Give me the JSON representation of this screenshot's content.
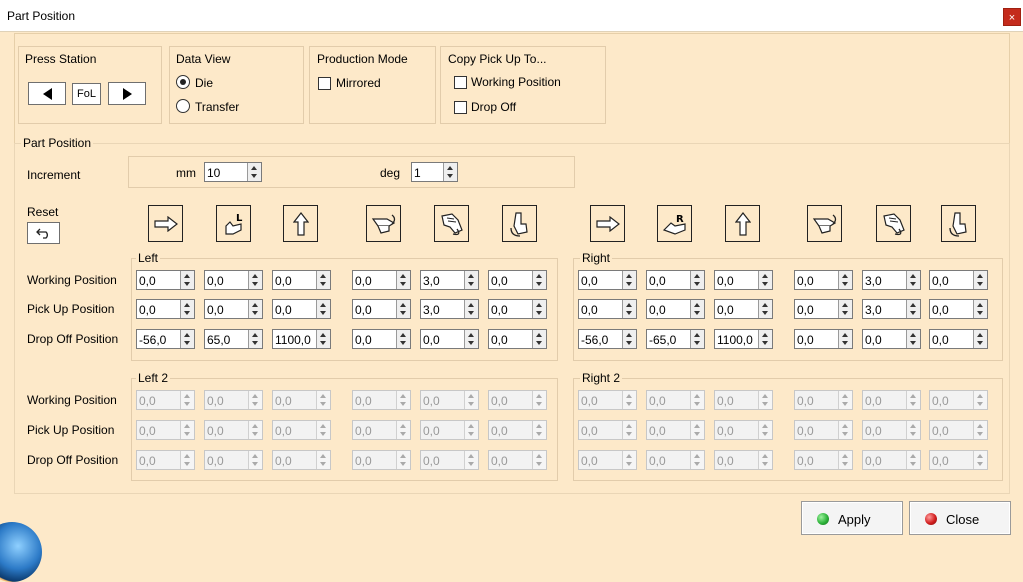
{
  "window": {
    "title": "Part Position",
    "close_glyph": "×"
  },
  "press_station": {
    "title": "Press Station",
    "value": "FoL"
  },
  "data_view": {
    "title": "Data View",
    "options": [
      "Die",
      "Transfer"
    ],
    "selected": "Die"
  },
  "production_mode": {
    "title": "Production Mode",
    "mirrored_label": "Mirrored",
    "mirrored_checked": false
  },
  "copy_pick_up": {
    "title": "Copy Pick Up To...",
    "working_label": "Working Position",
    "drop_off_label": "Drop Off"
  },
  "part_position": {
    "title": "Part Position",
    "increment_label": "Increment",
    "mm_label": "mm",
    "mm_value": "10",
    "deg_label": "deg",
    "deg_value": "1",
    "reset_label": "Reset",
    "icon_letters": {
      "left_rot": "L",
      "right_rot": "R"
    }
  },
  "row_labels": [
    "Working Position",
    "Pick Up Position",
    "Drop Off Position"
  ],
  "groups": {
    "left": {
      "title": "Left",
      "rows": [
        [
          "0,0",
          "0,0",
          "0,0",
          "0,0",
          "3,0",
          "0,0"
        ],
        [
          "0,0",
          "0,0",
          "0,0",
          "0,0",
          "3,0",
          "0,0"
        ],
        [
          "-56,0",
          "65,0",
          "1100,0",
          "0,0",
          "0,0",
          "0,0"
        ]
      ]
    },
    "right": {
      "title": "Right",
      "rows": [
        [
          "0,0",
          "0,0",
          "0,0",
          "0,0",
          "3,0",
          "0,0"
        ],
        [
          "0,0",
          "0,0",
          "0,0",
          "0,0",
          "3,0",
          "0,0"
        ],
        [
          "-56,0",
          "-65,0",
          "1100,0",
          "0,0",
          "0,0",
          "0,0"
        ]
      ]
    },
    "left2": {
      "title": "Left 2",
      "rows": [
        [
          "0,0",
          "0,0",
          "0,0",
          "0,0",
          "0,0",
          "0,0"
        ],
        [
          "0,0",
          "0,0",
          "0,0",
          "0,0",
          "0,0",
          "0,0"
        ],
        [
          "0,0",
          "0,0",
          "0,0",
          "0,0",
          "0,0",
          "0,0"
        ]
      ]
    },
    "right2": {
      "title": "Right 2",
      "rows": [
        [
          "0,0",
          "0,0",
          "0,0",
          "0,0",
          "0,0",
          "0,0"
        ],
        [
          "0,0",
          "0,0",
          "0,0",
          "0,0",
          "0,0",
          "0,0"
        ],
        [
          "0,0",
          "0,0",
          "0,0",
          "0,0",
          "0,0",
          "0,0"
        ]
      ]
    }
  },
  "buttons": {
    "apply": "Apply",
    "close": "Close"
  },
  "colors": {
    "background": "#fde9c9",
    "apply_dot": "#2db33a",
    "close_dot": "#d21e1e",
    "title_close": "#c42b1c"
  }
}
